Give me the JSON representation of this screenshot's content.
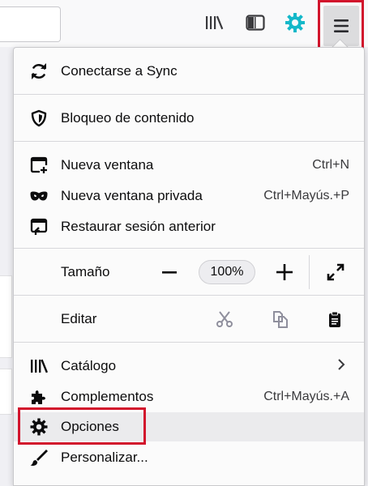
{
  "colors": {
    "highlight_red": "#d2142c",
    "sync_icon_teal": "#14b8c9"
  },
  "toolbar": {
    "icons": [
      "library-icon",
      "sidebar-icon",
      "extension-icon",
      "hamburger-menu-icon"
    ]
  },
  "menu": {
    "sync_label": "Conectarse a Sync",
    "content_blocking_label": "Bloqueo de contenido",
    "new_window_label": "Nueva ventana",
    "new_window_shortcut": "Ctrl+N",
    "private_window_label": "Nueva ventana privada",
    "private_window_shortcut": "Ctrl+Mayús.+P",
    "restore_session_label": "Restaurar sesión anterior",
    "zoom_label": "Tamaño",
    "zoom_value": "100%",
    "edit_label": "Editar",
    "library_label": "Catálogo",
    "addons_label": "Complementos",
    "addons_shortcut": "Ctrl+Mayús.+A",
    "options_label": "Opciones",
    "customize_label": "Personalizar..."
  }
}
